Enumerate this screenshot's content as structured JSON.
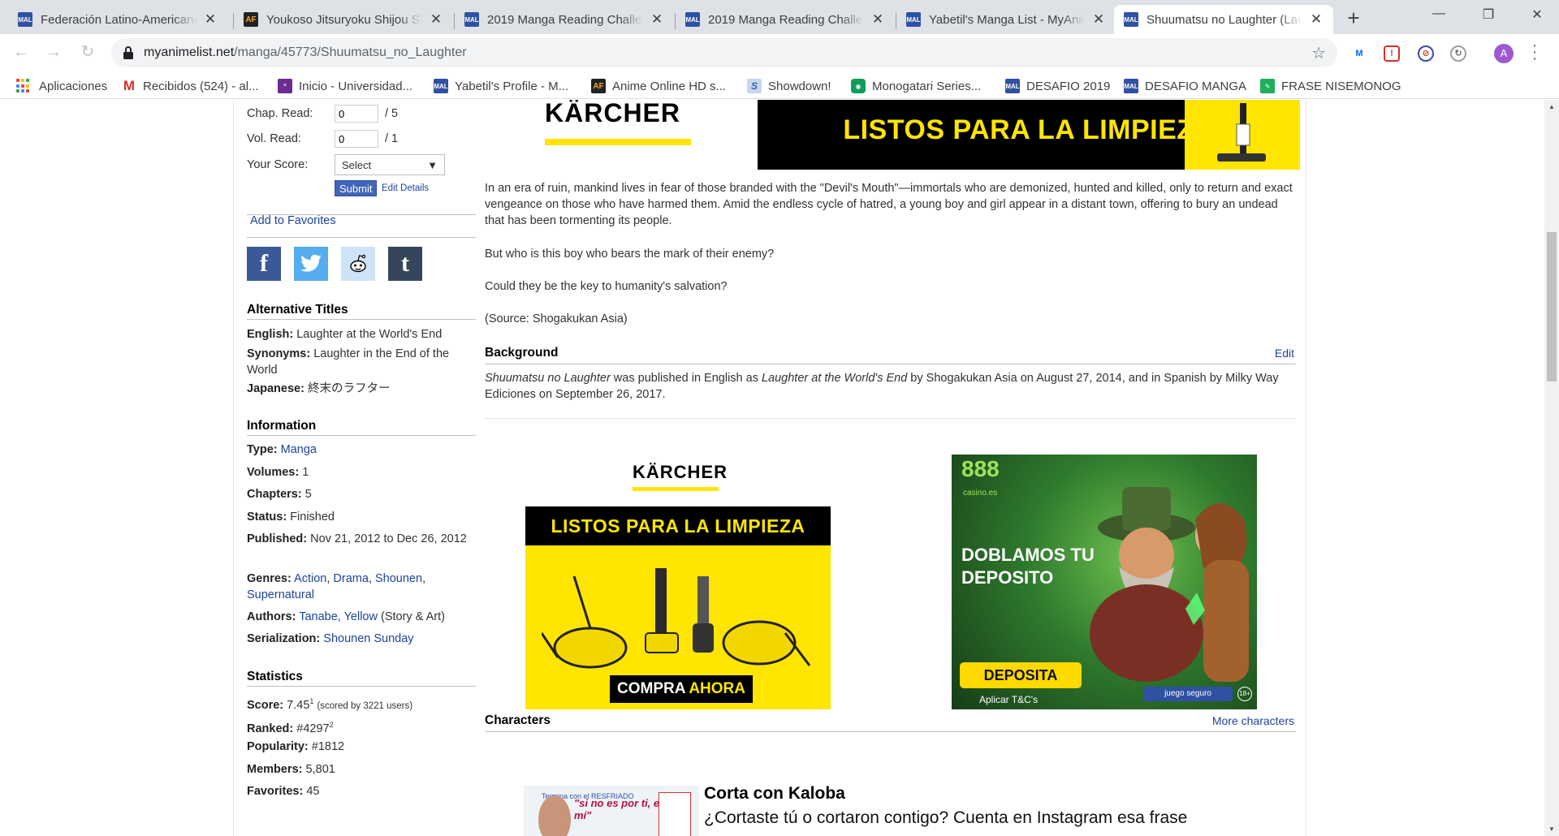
{
  "browser": {
    "tabs": [
      {
        "title": "Federación Latino-Americana",
        "favicon": "mal"
      },
      {
        "title": "Youkoso Jitsuryoku Shijou Sh",
        "favicon": "af"
      },
      {
        "title": "2019 Manga Reading Challen",
        "favicon": "mal"
      },
      {
        "title": "2019 Manga Reading Challen",
        "favicon": "mal"
      },
      {
        "title": "Yabetil's Manga List - MyAnim",
        "favicon": "mal"
      },
      {
        "title": "Shuumatsu no Laughter (Lau",
        "favicon": "mal",
        "active": true
      }
    ],
    "favicon_mal_label": "MAL",
    "favicon_af_label": "AF",
    "new_tab_icon": "+",
    "address": {
      "host": "myanimelist.net",
      "path": "/manga/45773/Shuumatsu_no_Laughter"
    },
    "profile_initial": "A",
    "bookmarks": [
      {
        "label": "Aplicaciones",
        "icon": "apps-grid"
      },
      {
        "label": "Recibidos (524) - al...",
        "icon": "gmail"
      },
      {
        "label": "Inicio - Universidad...",
        "icon": "uni"
      },
      {
        "label": "Yabetil's Profile - M...",
        "icon": "mal"
      },
      {
        "label": "Anime Online HD s...",
        "icon": "af"
      },
      {
        "label": "Showdown!",
        "icon": "showdown"
      },
      {
        "label": "Monogatari Series...",
        "icon": "monogatari"
      },
      {
        "label": "DESAFIO 2019",
        "icon": "mal"
      },
      {
        "label": "DESAFIO MANGA",
        "icon": "mal"
      },
      {
        "label": "FRASE NISEMONOG",
        "icon": "frase"
      }
    ]
  },
  "sidebar": {
    "chap_label": "Chap. Read:",
    "chap_value": "0",
    "chap_total": "/ 5",
    "vol_label": "Vol. Read:",
    "vol_value": "0",
    "vol_total": "/ 1",
    "score_label": "Your Score:",
    "score_selected": "Select",
    "submit_label": "Submit",
    "edit_details": "Edit Details",
    "add_favorites": "Add to Favorites",
    "share": [
      {
        "name": "facebook",
        "glyph": "f",
        "color": "#3b5998"
      },
      {
        "name": "twitter",
        "glyph": "t",
        "color": "#55acee"
      },
      {
        "name": "reddit",
        "glyph": "r",
        "color": "#cee3f8"
      },
      {
        "name": "tumblr",
        "glyph": "t",
        "color": "#35465c"
      }
    ],
    "alt_titles": {
      "heading": "Alternative Titles",
      "english_label": "English:",
      "english": "Laughter at the World's End",
      "synonyms_label": "Synonyms:",
      "synonyms": "Laughter in the End of the World",
      "japanese_label": "Japanese:",
      "japanese": "終末のラフター"
    },
    "information": {
      "heading": "Information",
      "type_label": "Type:",
      "type": "Manga",
      "volumes_label": "Volumes:",
      "volumes": "1",
      "chapters_label": "Chapters:",
      "chapters": "5",
      "status_label": "Status:",
      "status": "Finished",
      "published_label": "Published:",
      "published": "Nov 21, 2012 to Dec 26, 2012",
      "genres_label": "Genres:",
      "genres": [
        "Action",
        "Drama",
        "Shounen",
        "Supernatural"
      ],
      "authors_label": "Authors:",
      "authors_link": "Tanabe, Yellow",
      "authors_role": "(Story & Art)",
      "serialization_label": "Serialization:",
      "serialization": "Shounen Sunday"
    },
    "statistics": {
      "heading": "Statistics",
      "score_label": "Score:",
      "score": "7.45",
      "score_sup": "1",
      "score_note": "(scored by 3221 users)",
      "ranked_label": "Ranked:",
      "ranked": "#4297",
      "ranked_sup": "2",
      "popularity_label": "Popularity:",
      "popularity": "#1812",
      "members_label": "Members:",
      "members": "5,801",
      "favorites_label": "Favorites:",
      "favorites": "45"
    }
  },
  "main": {
    "synopsis": [
      "In an era of ruin, mankind lives in fear of those branded with the \"Devil's Mouth\"—immortals who are demonized, hunted and killed, only to return and exact vengeance on those who have harmed them. Amid the endless cycle of hatred, a young boy and girl appear in a distant town, offering to bury an undead that has been tormenting its people.",
      "But who is this boy who bears the mark of their enemy?",
      "Could they be the key to humanity's salvation?",
      "(Source: Shogakukan Asia)"
    ],
    "background": {
      "heading": "Background",
      "edit": "Edit",
      "title_italic": "Shuumatsu no Laughter",
      "text_1": " was published in English as ",
      "english_italic": "Laughter at the World's End",
      "text_2": " by Shogakukan Asia on August 27, 2014, and in Spanish by Milky Way Ediciones on September 26, 2017."
    },
    "characters": {
      "heading": "Characters",
      "more": "More characters"
    }
  },
  "ads": {
    "karcher_brand": "KÄRCHER",
    "karcher_slogan": "LISTOS PARA LA LIMPIEZA",
    "karcher_cta_1": "COMPRA",
    "karcher_cta_2": "AHORA",
    "casino_logo": "888",
    "casino_sub": "casino.es",
    "casino_headline_1": "DOBLAMOS TU",
    "casino_headline_2": "DEPOSITO",
    "casino_cta": "DEPOSITA",
    "casino_tc": "Aplicar T&C's",
    "casino_badge": "juego seguro",
    "casino_age": "18+",
    "bottom_small": "Termina con el RESFRIADO",
    "bottom_quote": "\"si no es por ti, es por mí\"",
    "bottom_title": "Corta con Kaloba",
    "bottom_desc": "¿Cortaste tú o cortaron contigo? Cuenta en Instagram esa frase"
  },
  "colors": {
    "mal_blue": "#2e51a2",
    "link": "#1c439b",
    "karcher_yellow": "#ffe500"
  }
}
